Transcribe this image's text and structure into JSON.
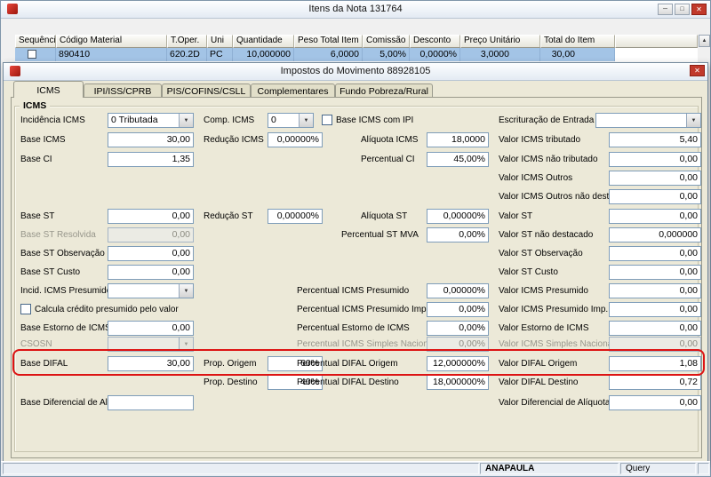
{
  "colors": {
    "annotation-red": "#dd1414",
    "selection-blue": "#a3c4e6",
    "close-red": "#c1392b"
  },
  "icons": {
    "minimize": "─",
    "maximize": "□",
    "close": "✕",
    "dropdown": "▼",
    "scroll_up": "▲"
  },
  "main_window": {
    "title": "Itens da Nota 131764",
    "grid": {
      "columns": [
        "Sequência",
        "Código Material",
        "T.Oper.",
        "Uni",
        "Quantidade",
        "Peso Total Item",
        "Comissão",
        "Desconto",
        "Preço Unitário",
        "Total do Item"
      ],
      "row": {
        "codigo_material": "890410",
        "t_oper": "620.2D",
        "uni": "PC",
        "quantidade": "10,000000",
        "peso_total_item": "6,0000",
        "comissao": "5,00%",
        "desconto": "0,0000%",
        "preco_unitario": "3,0000",
        "total_do_item": "30,00"
      }
    }
  },
  "dialog": {
    "title": "Impostos do Movimento 88928105",
    "tabs": [
      "ICMS",
      "IPI/ISS/CPRB",
      "PIS/COFINS/CSLL",
      "Complementares",
      "Fundo Pobreza/Rural"
    ],
    "group_label": "ICMS",
    "fields": {
      "incidencia_icms": {
        "label": "Incidência ICMS",
        "value": "0 Tributada"
      },
      "comp_icms": {
        "label": "Comp. ICMS",
        "value": "0"
      },
      "base_icms_com_ipi": {
        "label": "Base ICMS com IPI"
      },
      "escrituracao_entrada": {
        "label": "Escrituração de Entrada",
        "value": ""
      },
      "base_icms": {
        "label": "Base ICMS",
        "value": "30,00"
      },
      "reducao_icms": {
        "label": "Redução ICMS",
        "value": "0,00000%"
      },
      "aliquota_icms": {
        "label": "Alíquota ICMS",
        "value": "18,0000"
      },
      "valor_icms_tributado": {
        "label": "Valor ICMS tributado",
        "value": "5,40"
      },
      "base_ci": {
        "label": "Base CI",
        "value": "1,35"
      },
      "percentual_ci": {
        "label": "Percentual CI",
        "value": "45,00%"
      },
      "valor_icms_nao_tributado": {
        "label": "Valor ICMS não tributado",
        "value": "0,00"
      },
      "valor_icms_outros": {
        "label": "Valor ICMS Outros",
        "value": "0,00"
      },
      "valor_icms_outros_nao_dest": {
        "label": "Valor ICMS Outros não dest.",
        "value": "0,00"
      },
      "base_st": {
        "label": "Base ST",
        "value": "0,00"
      },
      "reducao_st": {
        "label": "Redução ST",
        "value": "0,00000%"
      },
      "aliquota_st": {
        "label": "Alíquota ST",
        "value": "0,00000%"
      },
      "valor_st": {
        "label": "Valor ST",
        "value": "0,00"
      },
      "base_st_resolvida": {
        "label": "Base ST Resolvida",
        "value": "0,00"
      },
      "percentual_st_mva": {
        "label": "Percentual ST MVA",
        "value": "0,00%"
      },
      "valor_st_nao_destacado": {
        "label": "Valor ST não destacado",
        "value": "0,000000"
      },
      "base_st_observacao": {
        "label": "Base ST Observação",
        "value": "0,00"
      },
      "valor_st_observacao": {
        "label": "Valor ST Observação",
        "value": "0,00"
      },
      "base_st_custo": {
        "label": "Base ST Custo",
        "value": "0,00"
      },
      "valor_st_custo": {
        "label": "Valor ST Custo",
        "value": "0,00"
      },
      "incid_icms_presumido": {
        "label": "Incid. ICMS Presumido",
        "value": ""
      },
      "percentual_icms_presumido": {
        "label": "Percentual ICMS Presumido",
        "value": "0,00000%"
      },
      "valor_icms_presumido": {
        "label": "Valor ICMS Presumido",
        "value": "0,00"
      },
      "calcula_credito_presumido": {
        "label": "Calcula crédito presumido pelo valor"
      },
      "percentual_icms_presumido_imp_pr": {
        "label": "Percentual ICMS Presumido Imp. PR",
        "value": "0,00%"
      },
      "valor_icms_presumido_imp_pr": {
        "label": "Valor ICMS Presumido Imp. PR",
        "value": "0,00"
      },
      "base_estorno_icms": {
        "label": "Base Estorno de ICMS",
        "value": "0,00"
      },
      "percentual_estorno_icms": {
        "label": "Percentual Estorno de ICMS",
        "value": "0,00%"
      },
      "valor_estorno_icms": {
        "label": "Valor Estorno de ICMS",
        "value": "0,00"
      },
      "csosn": {
        "label": "CSOSN",
        "value": ""
      },
      "percentual_icms_simples": {
        "label": "Percentual ICMS Simples Nacional",
        "value": "0,00%"
      },
      "valor_icms_simples": {
        "label": "Valor ICMS Simples Nacional",
        "value": "0,00"
      },
      "base_difal": {
        "label": "Base DIFAL",
        "value": "30,00"
      },
      "prop_origem": {
        "label": "Prop. Origem",
        "value": "60%"
      },
      "percentual_difal_origem": {
        "label": "Percentual DIFAL Origem",
        "value": "12,000000%"
      },
      "valor_difal_origem": {
        "label": "Valor DIFAL Origem",
        "value": "1,08"
      },
      "prop_destino": {
        "label": "Prop. Destino",
        "value": "40%"
      },
      "percentual_difal_destino": {
        "label": "Percentual DIFAL Destino",
        "value": "18,000000%"
      },
      "valor_difal_destino": {
        "label": "Valor DIFAL Destino",
        "value": "0,72"
      },
      "base_diferencial_aliq": {
        "label": "Base Diferencial de Alíq.",
        "value": ""
      },
      "valor_diferencial_aliquota": {
        "label": "Valor Diferencial de Alíquota",
        "value": "0,00"
      }
    }
  },
  "statusbar": {
    "user": "ANAPAULA",
    "mode": "Query"
  }
}
